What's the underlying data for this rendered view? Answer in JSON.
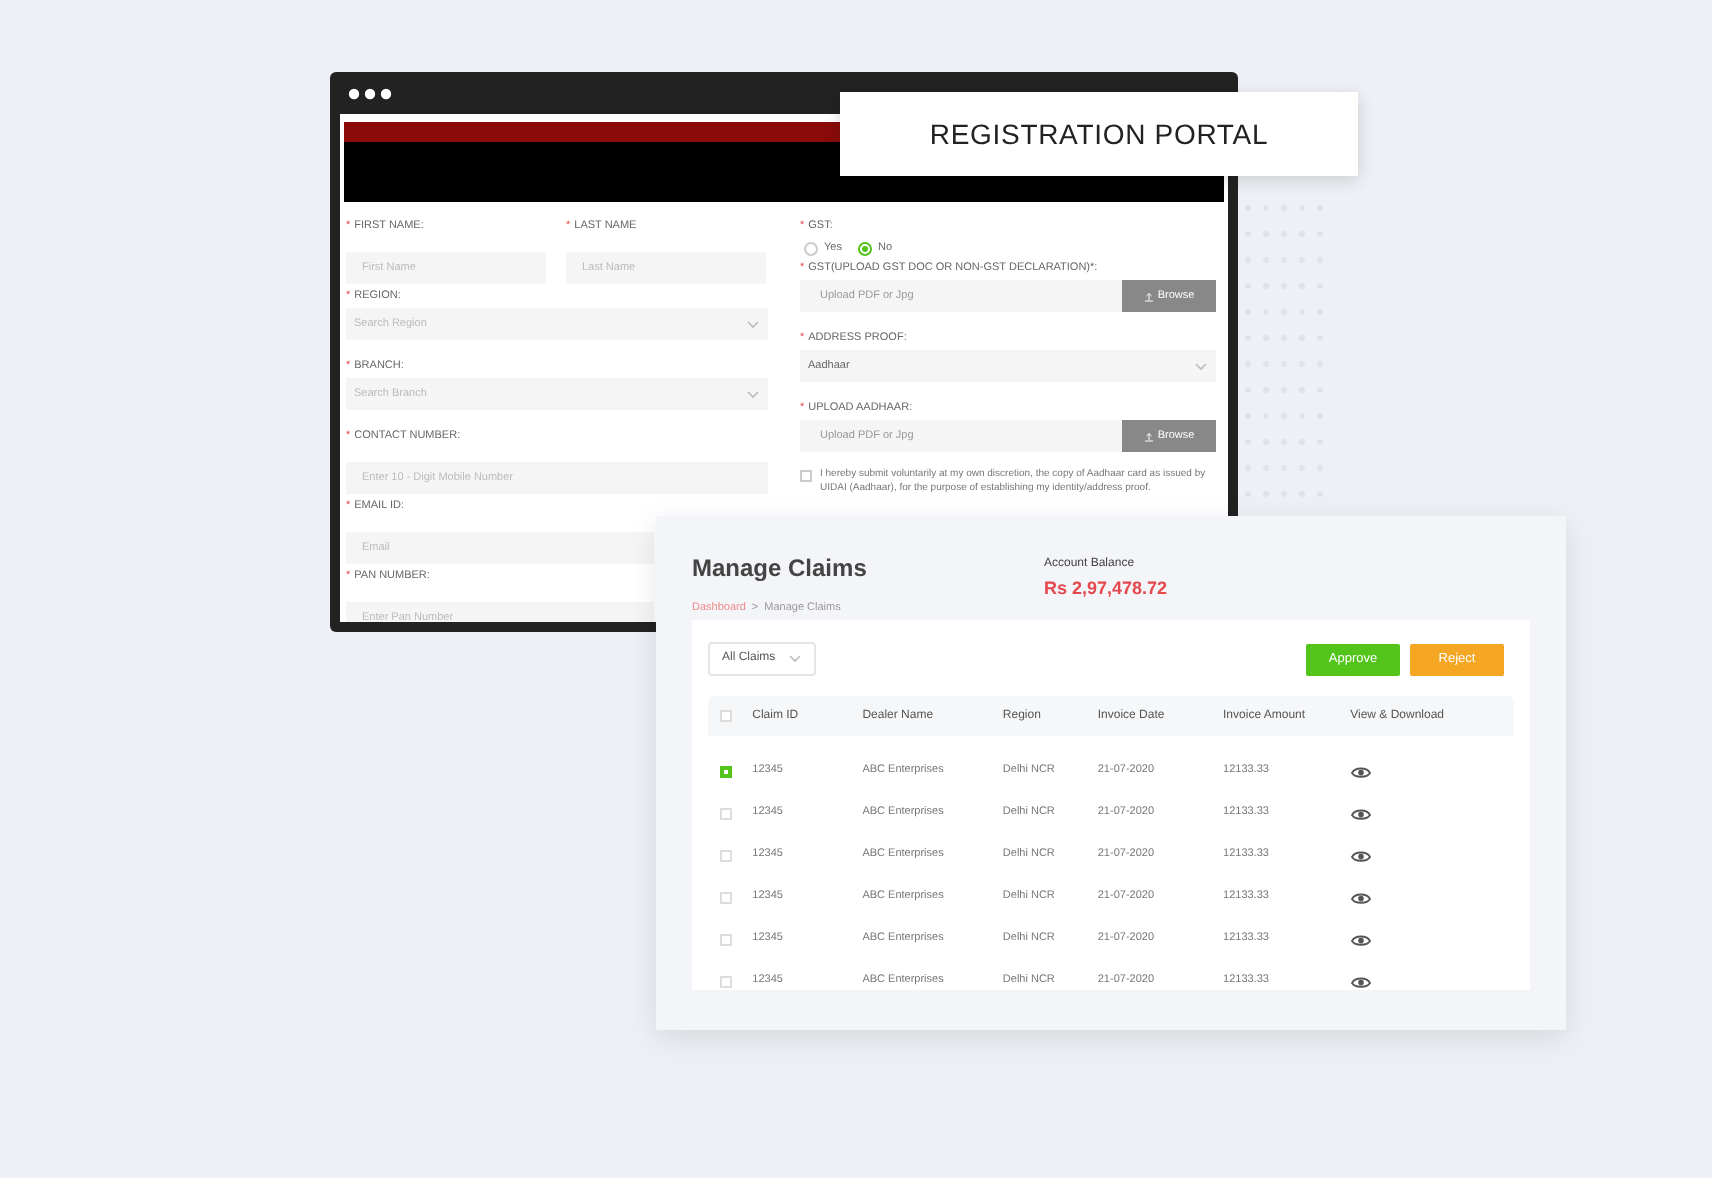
{
  "portal_label": "REGISTRATION PORTAL",
  "form": {
    "required_mark": "*",
    "left_fields": [
      {
        "kind": "pair",
        "items": [
          {
            "label": "FIRST NAME:",
            "placeholder": "First Name"
          },
          {
            "label": "LAST NAME",
            "placeholder": "Last Name"
          }
        ]
      },
      {
        "kind": "select",
        "label": "REGION:",
        "placeholder": "Search Region"
      },
      {
        "kind": "select",
        "label": "BRANCH:",
        "placeholder": "Search Branch"
      },
      {
        "kind": "text",
        "label": "CONTACT NUMBER:",
        "placeholder": "Enter 10 - Digit Mobile Number"
      },
      {
        "kind": "partial",
        "label": "EMAIL ID:",
        "placeholder": "Email"
      },
      {
        "kind": "partial",
        "label": "PAN NUMBER:",
        "placeholder": "Enter Pan Number"
      }
    ],
    "gst": {
      "label": "GST:",
      "options": [
        {
          "label": "Yes",
          "selected": false
        },
        {
          "label": "No",
          "selected": true
        }
      ]
    },
    "right_fields": [
      {
        "kind": "upload",
        "label": "GST(UPLOAD GST DOC OR NON-GST DECLARATION)*:",
        "placeholder": "Upload PDF or Jpg",
        "button": "Browse"
      },
      {
        "kind": "select",
        "label": "ADDRESS PROOF:",
        "value": "Aadhaar"
      },
      {
        "kind": "upload",
        "label": "UPLOAD AADHAAR:",
        "placeholder": "Upload PDF or Jpg",
        "button": "Browse"
      }
    ],
    "consent": {
      "checked": false,
      "text": "I hereby submit voluntarily at my own discretion, the copy of Aadhaar card as issued by UIDAI (Aadhaar), for the purpose of establishing my identity/address proof."
    }
  },
  "claims": {
    "title": "Manage Claims",
    "balance_label": "Account Balance",
    "balance": "Rs 2,97,478.72",
    "breadcrumb": [
      "Dashboard",
      "Manage Claims"
    ],
    "breadcrumb_sep": ">",
    "filter": "All Claims",
    "buttons": [
      {
        "label": "Approve",
        "color": "#52c41a"
      },
      {
        "label": "Reject",
        "color": "#f5a623"
      }
    ],
    "columns": [
      "Claim ID",
      "Dealer Name",
      "Region",
      "Invoice Date",
      "Invoice Amount",
      "View & Download"
    ],
    "header_checked": false,
    "rows": [
      {
        "selected": true,
        "cells": [
          "12345",
          "ABC Enterprises",
          "Delhi NCR",
          "21-07-2020",
          "12133.33"
        ]
      },
      {
        "selected": false,
        "cells": [
          "12345",
          "ABC Enterprises",
          "Delhi NCR",
          "21-07-2020",
          "12133.33"
        ]
      },
      {
        "selected": false,
        "cells": [
          "12345",
          "ABC Enterprises",
          "Delhi NCR",
          "21-07-2020",
          "12133.33"
        ]
      },
      {
        "selected": false,
        "cells": [
          "12345",
          "ABC Enterprises",
          "Delhi NCR",
          "21-07-2020",
          "12133.33"
        ]
      },
      {
        "selected": false,
        "cells": [
          "12345",
          "ABC Enterprises",
          "Delhi NCR",
          "21-07-2020",
          "12133.33"
        ]
      },
      {
        "selected": false,
        "cells": [
          "12345",
          "ABC Enterprises",
          "Delhi NCR",
          "21-07-2020",
          "12133.33"
        ]
      }
    ]
  }
}
